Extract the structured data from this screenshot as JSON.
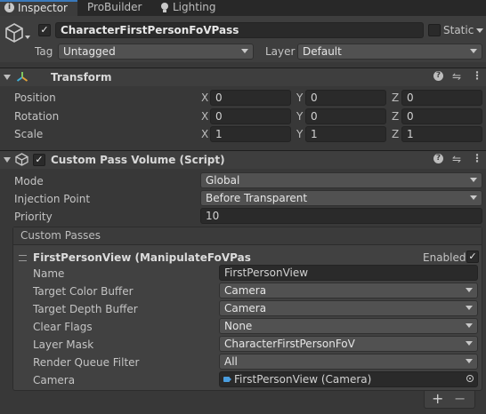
{
  "tabs": [
    {
      "label": "Inspector",
      "icon": "info-icon",
      "active": true
    },
    {
      "label": "ProBuilder",
      "active": false
    },
    {
      "label": "Lighting",
      "icon": "bulb-icon",
      "active": false
    }
  ],
  "gameobject": {
    "name": "CharacterFirstPersonFoVPass",
    "active": true,
    "static_label": "Static",
    "tag_label": "Tag",
    "tag_value": "Untagged",
    "layer_label": "Layer",
    "layer_value": "Default"
  },
  "transform": {
    "title": "Transform",
    "rows": [
      {
        "label": "Position",
        "x": "0",
        "y": "0",
        "z": "0"
      },
      {
        "label": "Rotation",
        "x": "0",
        "y": "0",
        "z": "0"
      },
      {
        "label": "Scale",
        "x": "1",
        "y": "1",
        "z": "1"
      }
    ],
    "axis": {
      "x": "X",
      "y": "Y",
      "z": "Z"
    }
  },
  "custom_pass_volume": {
    "title": "Custom Pass Volume (Script)",
    "mode_label": "Mode",
    "mode_value": "Global",
    "injection_label": "Injection Point",
    "injection_value": "Before Transparent",
    "priority_label": "Priority",
    "priority_value": "10",
    "custom_passes_label": "Custom Passes",
    "pass": {
      "title": "FirstPersonView (ManipulateFoVPas",
      "enabled_label": "Enabled",
      "enabled": true,
      "fields": [
        {
          "label": "Name",
          "value": "FirstPersonView",
          "kind": "text"
        },
        {
          "label": "Target Color Buffer",
          "value": "Camera",
          "kind": "dropdown"
        },
        {
          "label": "Target Depth Buffer",
          "value": "Camera",
          "kind": "dropdown"
        },
        {
          "label": "Clear Flags",
          "value": "None",
          "kind": "dropdown"
        },
        {
          "label": "Layer Mask",
          "value": "CharacterFirstPersonFoV",
          "kind": "dropdown"
        },
        {
          "label": "Render Queue Filter",
          "value": "All",
          "kind": "dropdown"
        },
        {
          "label": "Camera",
          "value": "FirstPersonView (Camera)",
          "kind": "object"
        }
      ]
    },
    "add_label": "+",
    "remove_label": "−"
  },
  "colors": {
    "accent_transform": "#3fb0d8",
    "background": "#383838"
  }
}
